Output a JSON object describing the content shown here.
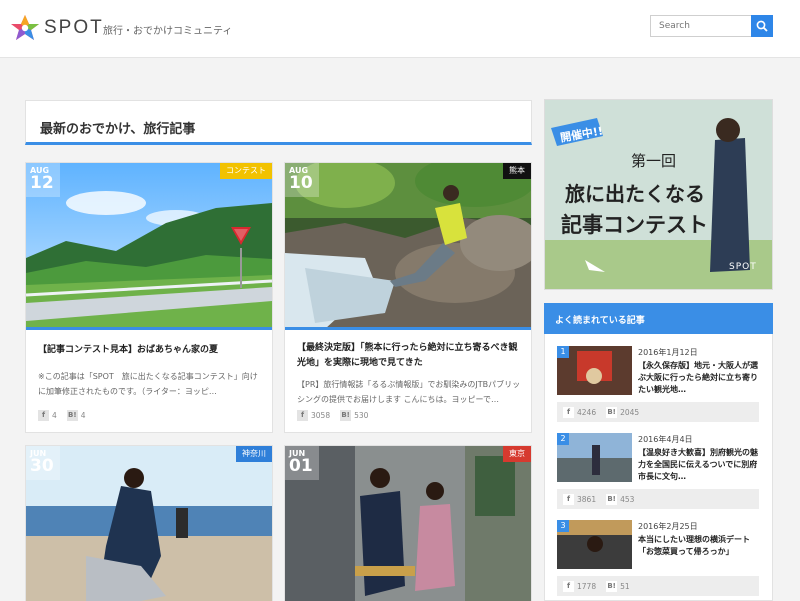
{
  "header": {
    "brand": "SPOT",
    "tagline": "旅行・おでかけコミュニティ",
    "search_placeholder": "Search"
  },
  "main": {
    "section_title": "最新のおでかけ、旅行記事",
    "articles": [
      {
        "month": "AUG",
        "day": "12",
        "tag": "コンテスト",
        "tag_color": "#f2c200",
        "title": "【記事コンテスト見本】おばあちゃん家の夏",
        "excerpt": "※この記事は「SPOT　旅に出たくなる記事コンテスト」向けに加筆修正されたものです。（ライター：ヨッピ…",
        "fb": "4",
        "hb": "4"
      },
      {
        "month": "AUG",
        "day": "10",
        "tag": "熊本",
        "tag_color": "#111111",
        "title": "【最終決定版】「熊本に行ったら絶対に立ち寄るべき観光地」を実際に現地で見てきた",
        "excerpt": "【PR】旅行情報誌「るるぶ情報版」でお馴染みのJTBパブリッシングの提供でお届けします こんにちは。ヨッピーで…",
        "fb": "3058",
        "hb": "530"
      },
      {
        "month": "JUN",
        "day": "30",
        "tag": "神奈川",
        "tag_color": "#2f7fd9"
      },
      {
        "month": "JUN",
        "day": "01",
        "tag": "東京",
        "tag_color": "#d63a2f"
      }
    ]
  },
  "sidebar": {
    "banner": {
      "badge": "開催中!!",
      "line1": "第一回",
      "line2": "旅に出たくなる",
      "line3": "記事コンテスト",
      "logo": "SPOT"
    },
    "popular_title": "よく読まれている記事",
    "popular": [
      {
        "rank": "1",
        "date": "2016年1月12日",
        "title": "【永久保存版】地元・大阪人が選ぶ大阪に行ったら絶対に立ち寄りたい観光地…",
        "fb": "4246",
        "hb": "2045"
      },
      {
        "rank": "2",
        "date": "2016年4月4日",
        "title": "【温泉好き大歓喜】別府観光の魅力を全国民に伝えるついでに別府市長に文句…",
        "fb": "3861",
        "hb": "453"
      },
      {
        "rank": "3",
        "date": "2016年2月25日",
        "title": "本当にしたい理想の横浜デート「お惣菜買って帰ろっか」",
        "fb": "1778",
        "hb": "51"
      }
    ]
  },
  "icons": {
    "facebook": "f",
    "hatena": "B!"
  },
  "colors": {
    "accent": "#3a8ee6",
    "search_button": "#2e86e8"
  }
}
